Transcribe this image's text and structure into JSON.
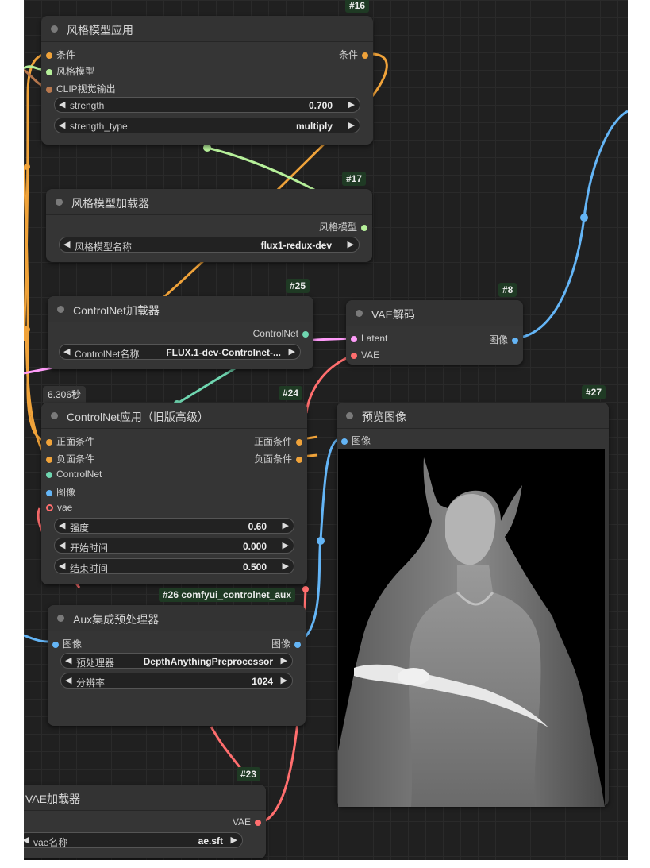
{
  "colors": {
    "conditioning": "#f0a33a",
    "style_model": "#b6f09a",
    "clip_vision": "#b8784e",
    "controlnet": "#6fd6b0",
    "image": "#64b5f6",
    "latent": "#ff9cf9",
    "vae": "#ff6e6e"
  },
  "nodes": {
    "style_apply": {
      "badge": "#16",
      "title": "风格模型应用",
      "in1": "条件",
      "in2": "风格模型",
      "in3": "CLIP视觉输出",
      "out1": "条件",
      "w1_label": "strength",
      "w1_value": "0.700",
      "w2_label": "strength_type",
      "w2_value": "multiply"
    },
    "style_loader": {
      "badge": "#17",
      "title": "风格模型加载器",
      "out1": "风格模型",
      "w1_label": "风格模型名称",
      "w1_value": "flux1-redux-dev"
    },
    "cn_loader": {
      "badge": "#25",
      "title": "ControlNet加载器",
      "out1": "ControlNet",
      "w1_label": "ControlNet名称",
      "w1_value": "FLUX.1-dev-Controlnet-..."
    },
    "vae_decode": {
      "badge": "#8",
      "title": "VAE解码",
      "in1": "Latent",
      "in2": "VAE",
      "out1": "图像"
    },
    "cn_apply": {
      "badge": "#24",
      "timing": "6.306秒",
      "title": "ControlNet应用（旧版高级）",
      "in1": "正面条件",
      "in2": "负面条件",
      "in3": "ControlNet",
      "in4": "图像",
      "in5": "vae",
      "out1": "正面条件",
      "out2": "负面条件",
      "w1_label": "强度",
      "w1_value": "0.60",
      "w2_label": "开始时间",
      "w2_value": "0.000",
      "w3_label": "结束时间",
      "w3_value": "0.500"
    },
    "preview": {
      "badge": "#27",
      "title": "预览图像",
      "in1": "图像"
    },
    "aux": {
      "badge": "#26 comfyui_controlnet_aux",
      "title": "Aux集成预处理器",
      "in1": "图像",
      "out1": "图像",
      "w1_label": "预处理器",
      "w1_value": "DepthAnythingPreprocessor",
      "w2_label": "分辨率",
      "w2_value": "1024"
    },
    "vae_loader": {
      "badge": "#23",
      "title": "VAE加载器",
      "out1": "VAE",
      "w1_label": "vae名称",
      "w1_value": "ae.sft"
    }
  }
}
